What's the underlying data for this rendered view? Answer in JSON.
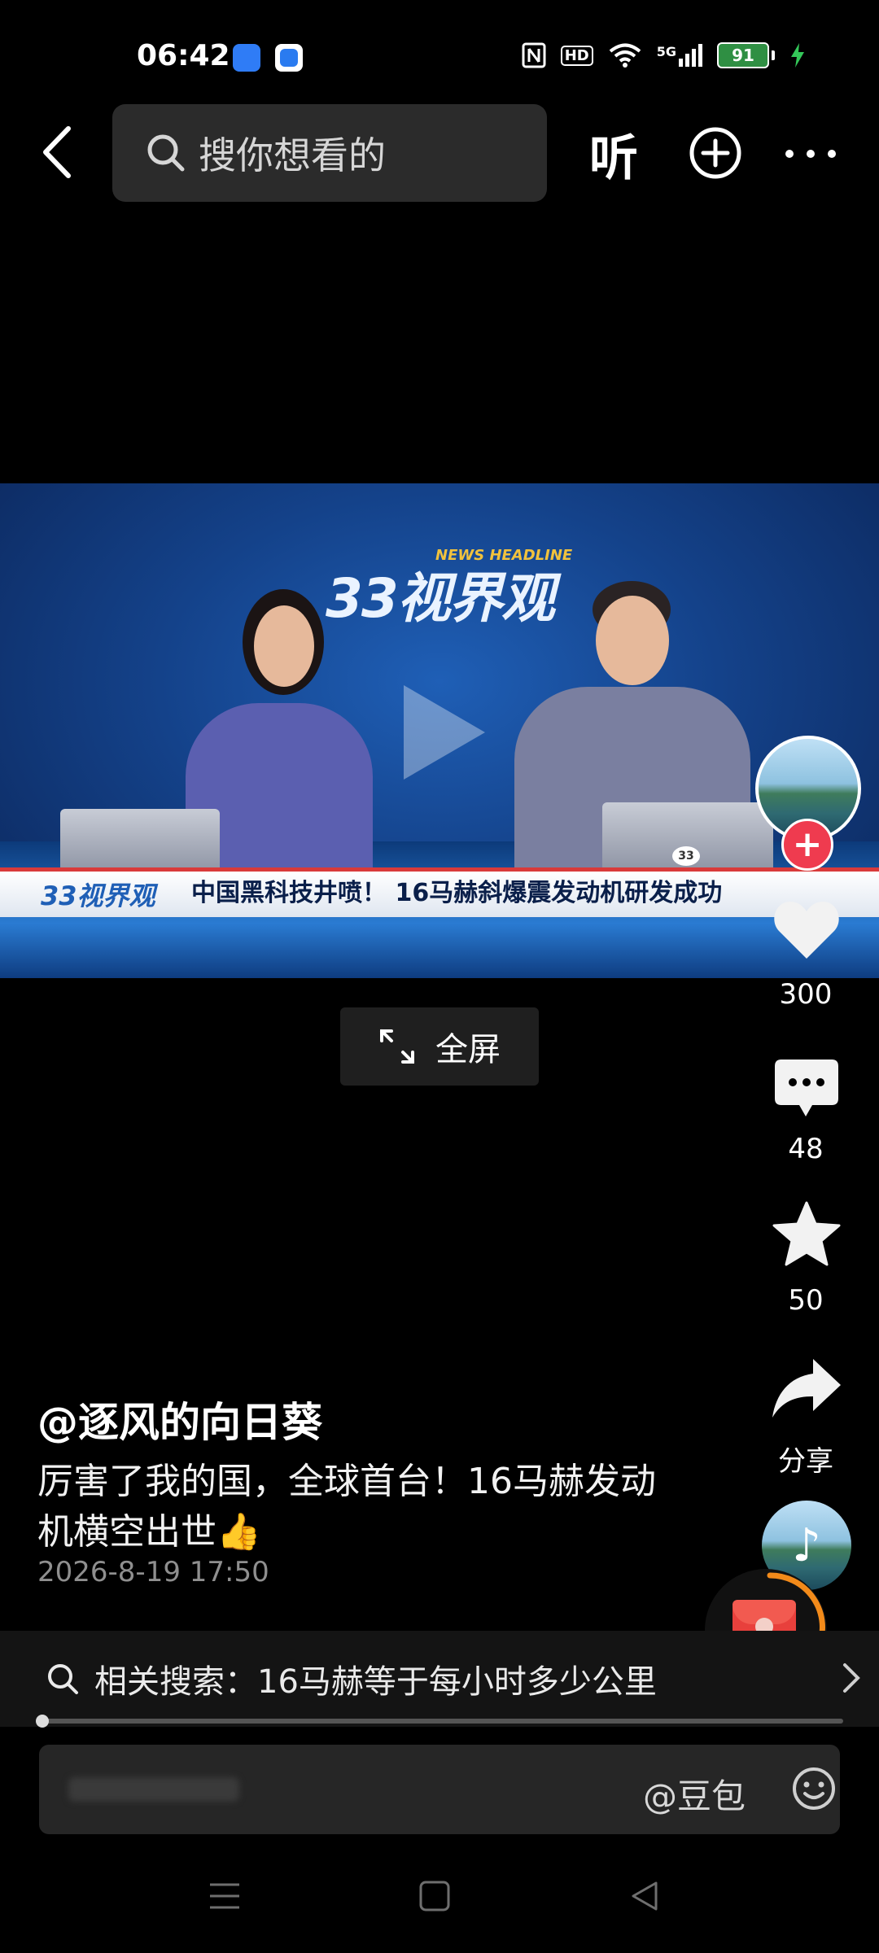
{
  "status_bar": {
    "time": "06:42",
    "icons": [
      "nfc-icon",
      "hd-icon",
      "wifi-icon",
      "5g-signal-icon",
      "charging-icon"
    ],
    "network": "5G",
    "hd": "HD",
    "battery": "91"
  },
  "top_bar": {
    "search_placeholder": "搜你想看的",
    "listen_label": "听"
  },
  "video": {
    "channel_logo": "33视界观",
    "channel_logo_sub": "NEWS HEADLINE",
    "desk_badge": "33",
    "ticker_text": "中国黑科技井喷！ 16马赫斜爆震发动机研发成功"
  },
  "fullscreen_label": "全屏",
  "side_rail": {
    "likes": "300",
    "comments": "48",
    "favorites": "50",
    "share_label": "分享"
  },
  "post": {
    "username": "@逐风的向日葵",
    "caption": "厉害了我的国，全球首台！16马赫发动机横空出世👍",
    "date": "2026-8-19 17:50"
  },
  "related_search": "相关搜索：16马赫等于每小时多少公里",
  "playback_progress": 0.0,
  "comment_bar": {
    "mention": "@豆包"
  },
  "colors": {
    "background": "#000000",
    "like_follow_red": "#ef3b4f",
    "red_packet": "#e8403c",
    "progress_ring": "#f28a1a",
    "battery_green": "#2f8f43"
  }
}
